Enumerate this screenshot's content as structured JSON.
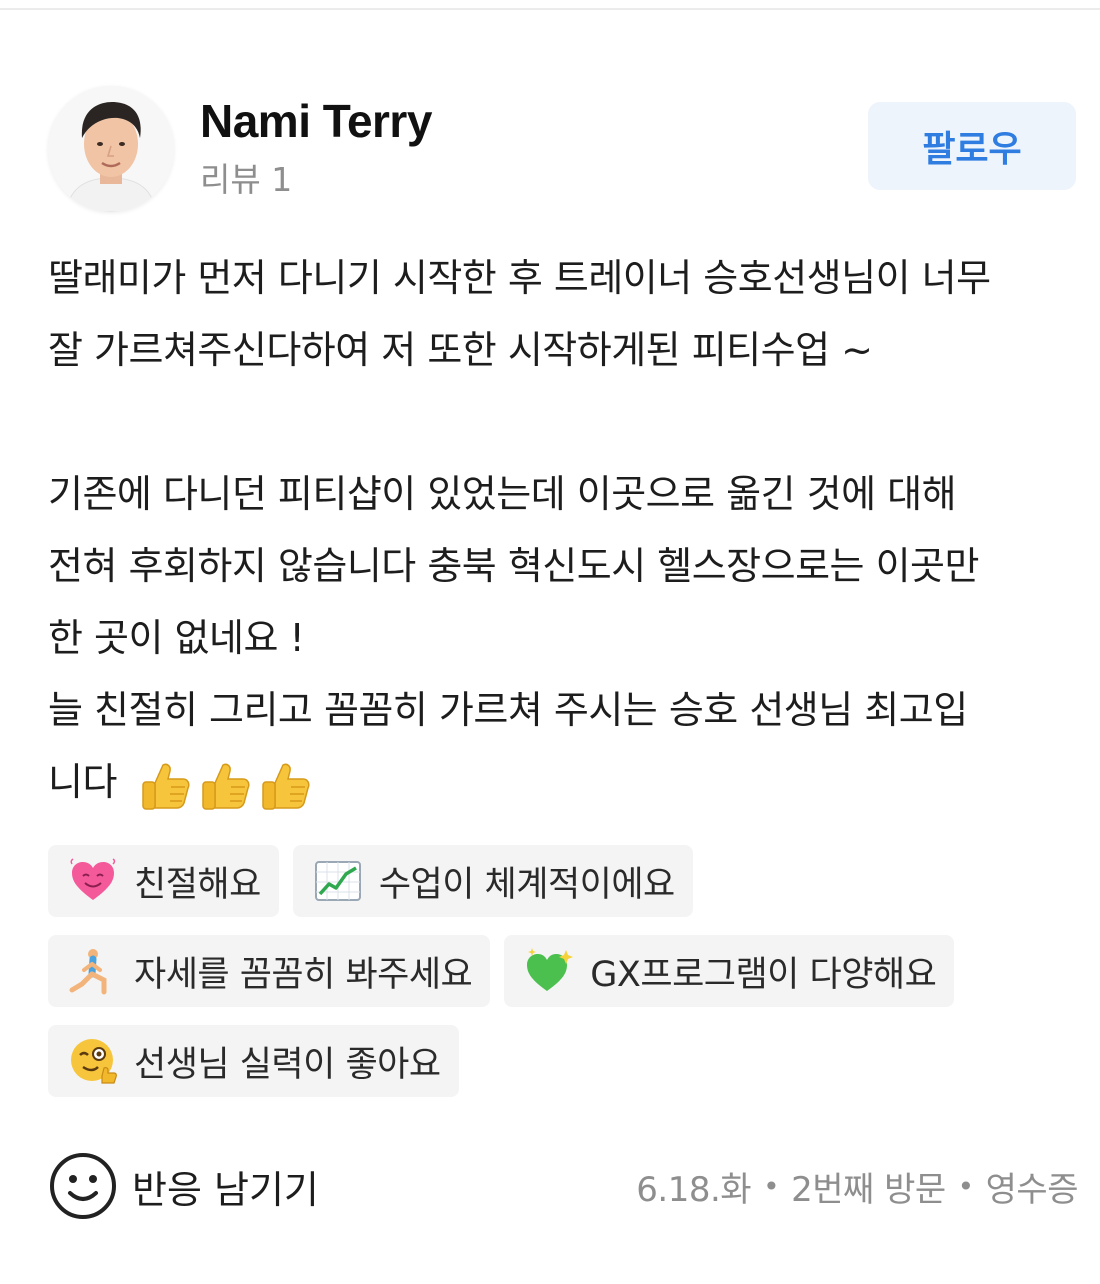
{
  "author": {
    "name": "Nami Terry",
    "review_count_label": "리뷰 1"
  },
  "follow_button": {
    "label": "팔로우"
  },
  "review": {
    "lines": [
      "딸래미가 먼저 다니기 시작한 후 트레이너 승호선생님이 너무",
      "잘 가르쳐주신다하여 저 또한 시작하게된 피티수업 ~",
      "",
      "기존에 다니던 피티샵이 있었는데 이곳으로 옮긴 것에 대해",
      "전혀 후회하지 않습니다 충북 혁신도시 헬스장으로는 이곳만",
      "한 곳이 없네요 !",
      "늘 친절히 그리고 꼼꼼히 가르쳐 주시는 승호 선생님 최고입",
      "니다"
    ],
    "emoji_icons": [
      "thumbs-up-icon",
      "thumbs-up-icon",
      "thumbs-up-icon"
    ]
  },
  "tags": [
    {
      "label": "친절해요",
      "icon": "heart-smile-icon"
    },
    {
      "label": "수업이 체계적이에요",
      "icon": "chart-up-icon"
    },
    {
      "label": "자세를 꼼꼼히 봐주세요",
      "icon": "lunge-person-icon"
    },
    {
      "label": "GX프로그램이 다양해요",
      "icon": "sparkling-heart-icon"
    },
    {
      "label": "선생님 실력이 좋아요",
      "icon": "wink-thumbs-icon"
    }
  ],
  "footer": {
    "react_label": "반응 남기기",
    "date": "6.18.화",
    "visit": "2번째 방문",
    "verification": "영수증",
    "separator": "•"
  },
  "colors": {
    "accent": "#2f7de1",
    "follow_bg": "#eef4fb",
    "tag_bg": "#f4f4f5",
    "muted_text": "#8e8e8e"
  }
}
